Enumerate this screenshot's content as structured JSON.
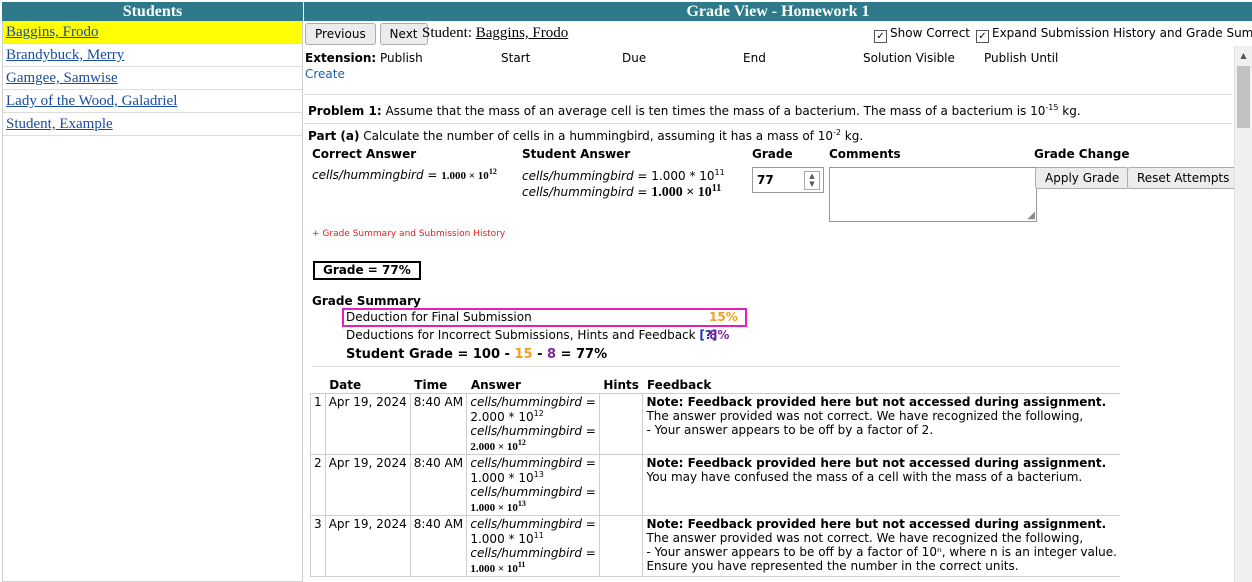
{
  "students_panel": {
    "title": "Students",
    "students": [
      "Baggins, Frodo",
      "Brandybuck, Merry",
      "Gamgee, Samwise",
      "Lady of the Wood, Galadriel",
      "Student, Example"
    ]
  },
  "grade_view": {
    "title": "Grade View - Homework 1",
    "previous_label": "Previous",
    "next_label": "Next",
    "student_label": "Student:",
    "student_name": "Baggins, Frodo",
    "show_correct_label": "Show Correct",
    "show_correct_checked": true,
    "expand_label": "Expand Submission History and Grade Summary",
    "expand_checked": true
  },
  "extension": {
    "label": "Extension:",
    "columns": [
      "Publish",
      "Start",
      "Due",
      "End",
      "Solution Visible",
      "Publish Until"
    ],
    "create_label": "Create"
  },
  "problem": {
    "label": "Problem 1:",
    "text": "Assume that the mass of an average cell is ten times the mass of a bacterium. The mass of a bacterium is 10",
    "exp": "-15",
    "unit": " kg."
  },
  "part": {
    "label": "Part (a)",
    "text": "Calculate the number of cells in a hummingbird, assuming it has a mass of 10",
    "exp": "-2",
    "unit": " kg."
  },
  "answer_table": {
    "headers": {
      "correct": "Correct Answer",
      "student": "Student Answer",
      "grade": "Grade",
      "comments": "Comments",
      "grade_change": "Grade Change"
    },
    "correct_var": "cells/hummingbird",
    "correct_value": "1.000 × 10",
    "correct_exp": "12",
    "student_var_1": "cells/hummingbird",
    "student_value_1": "1.000 * 10",
    "student_exp_1": "11",
    "student_var_2": "cells/hummingbird",
    "student_value_2": "1.000 × 10",
    "student_exp_2": "11",
    "grade_value": "77",
    "comments_value": "",
    "apply_grade_label": "Apply Grade",
    "reset_attempts_label": "Reset Attempts"
  },
  "summary_link": "+ Grade Summary and Submission History",
  "grade_box": "Grade = 77%",
  "grade_summary": {
    "title": "Grade Summary",
    "final_label": "Deduction for Final Submission",
    "final_value": "15%",
    "incorrect_label": "Deductions for Incorrect Submissions, Hints and Feedback",
    "help_label": "[?]",
    "incorrect_value": "8%",
    "student_grade_prefix": "Student Grade = 100 - ",
    "deduct1": "15",
    "minus": " - ",
    "deduct2": "8",
    "result": " = 77%",
    "colors": {
      "final": "#f0a020",
      "incorrect": "#7a2a9a",
      "highlight": "#e020c0"
    }
  },
  "history": {
    "headers": [
      "Date",
      "Time",
      "Answer",
      "Hints",
      "Feedback"
    ],
    "rows": [
      {
        "num": "1",
        "date": "Apr 19, 2024",
        "time": "8:40 AM",
        "a_var1": "cells/hummingbird =",
        "a_val1": "2.000 * 10",
        "a_exp1": "12",
        "a_var2": "cells/hummingbird =",
        "a_val2": "2.000 × 10",
        "a_exp2": "12",
        "hints": "",
        "fb_note": "Note: Feedback provided here but not accessed during assignment.",
        "fb_lines": [
          "The answer provided was not correct. We have recognized the following,",
          "- Your answer appears to be off by a factor of 2."
        ]
      },
      {
        "num": "2",
        "date": "Apr 19, 2024",
        "time": "8:40 AM",
        "a_var1": "cells/hummingbird =",
        "a_val1": "1.000 * 10",
        "a_exp1": "13",
        "a_var2": "cells/hummingbird =",
        "a_val2": "1.000 × 10",
        "a_exp2": "13",
        "hints": "",
        "fb_note": "Note: Feedback provided here but not accessed during assignment.",
        "fb_lines": [
          "You may have confused the mass of a cell with the mass of a bacterium."
        ]
      },
      {
        "num": "3",
        "date": "Apr 19, 2024",
        "time": "8:40 AM",
        "a_var1": "cells/hummingbird =",
        "a_val1": "1.000 * 10",
        "a_exp1": "11",
        "a_var2": "cells/hummingbird =",
        "a_val2": "1.000 × 10",
        "a_exp2": "11",
        "hints": "",
        "fb_note": "Note: Feedback provided here but not accessed during assignment.",
        "fb_lines": [
          "The answer provided was not correct. We have recognized the following,",
          "- Your answer appears to be off by a factor of 10ⁿ, where n is an integer value.",
          "Ensure you have represented the number in the correct units."
        ]
      }
    ]
  }
}
